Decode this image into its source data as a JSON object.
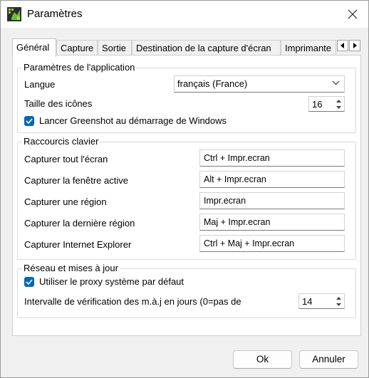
{
  "window": {
    "title": "Paramètres"
  },
  "tabs": [
    {
      "label": "Général",
      "active": true
    },
    {
      "label": "Capture"
    },
    {
      "label": "Sortie"
    },
    {
      "label": "Destination de la capture d'écran"
    },
    {
      "label": "Imprimante"
    }
  ],
  "app_settings": {
    "legend": "Paramètres de l'application",
    "language_label": "Langue",
    "language_value": "français (France)",
    "icon_size_label": "Taille des icônes",
    "icon_size_value": "16",
    "startup_label": "Lancer Greenshot au démarrage de Windows",
    "startup_checked": true
  },
  "hotkeys": {
    "legend": "Raccourcis clavier",
    "items": [
      {
        "label": "Capturer tout l'écran",
        "value": "Ctrl + Impr.ecran"
      },
      {
        "label": "Capturer la fenêtre active",
        "value": "Alt + Impr.ecran"
      },
      {
        "label": "Capturer une région",
        "value": "Impr.ecran"
      },
      {
        "label": "Capturer la dernière région",
        "value": "Maj + Impr.ecran"
      },
      {
        "label": "Capturer Internet Explorer",
        "value": "Ctrl + Maj + Impr.ecran"
      }
    ]
  },
  "network": {
    "legend": "Réseau et mises à jour",
    "proxy_label": "Utiliser le proxy système par défaut",
    "proxy_checked": true,
    "interval_label": "Intervalle de vérification des m.à.j en jours (0=pas de",
    "interval_value": "14"
  },
  "buttons": {
    "ok": "Ok",
    "cancel": "Annuler"
  },
  "colors": {
    "accent": "#0067c0",
    "border": "#d0d0d0",
    "background": "#f0f0f0"
  }
}
